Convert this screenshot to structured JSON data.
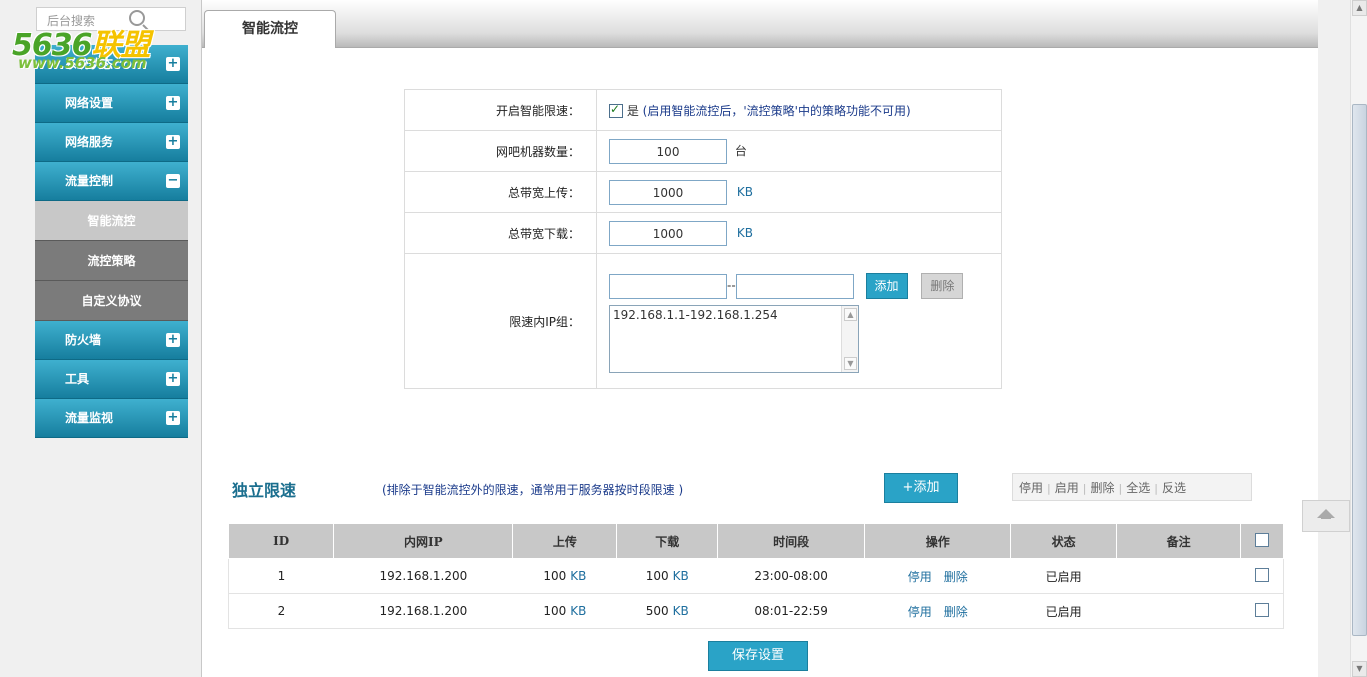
{
  "search": {
    "placeholder": "后台搜索"
  },
  "logo": {
    "main_a": "5636",
    "main_b": "联盟",
    "sub": "www.5636.com"
  },
  "sidebar": {
    "items": [
      {
        "label": "系统状态",
        "expanded": false
      },
      {
        "label": "网络设置",
        "expanded": false
      },
      {
        "label": "网络服务",
        "expanded": false
      },
      {
        "label": "流量控制",
        "expanded": true
      },
      {
        "label": "防火墙",
        "expanded": false
      },
      {
        "label": "工具",
        "expanded": false
      },
      {
        "label": "流量监视",
        "expanded": false
      }
    ],
    "sub_items": [
      {
        "label": "智能流控",
        "active": true
      },
      {
        "label": "流控策略",
        "active": false
      },
      {
        "label": "自定义协议",
        "active": false
      }
    ],
    "plus": "+",
    "minus": "−"
  },
  "tab": {
    "label": "智能流控"
  },
  "form": {
    "enable": {
      "label": "开启智能限速：",
      "checked": true,
      "check_text": "是",
      "hint": "(启用智能流控后，'流控策略'中的策略功能不可用)"
    },
    "machines": {
      "label": "网吧机器数量：",
      "value": "100",
      "unit": "台"
    },
    "upload": {
      "label": "总带宽上传：",
      "value": "1000",
      "unit": "KB"
    },
    "download": {
      "label": "总带宽下载：",
      "value": "1000",
      "unit": "KB"
    },
    "ipgroup": {
      "label": "限速内IP组：",
      "start_value": "",
      "end_value": "",
      "dash": "--",
      "add_label": "添加",
      "delete_label": "删除",
      "list": "192.168.1.1-192.168.1.254"
    }
  },
  "independent": {
    "title": "独立限速",
    "hint": "(排除于智能流控外的限速，通常用于服务器按时段限速 )",
    "add_label": "+添加",
    "actions": [
      "停用",
      "启用",
      "删除",
      "全选",
      "反选"
    ],
    "columns": [
      "ID",
      "内网IP",
      "上传",
      "下载",
      "时间段",
      "操作",
      "状态",
      "备注"
    ],
    "rows": [
      {
        "id": "1",
        "ip": "192.168.1.200",
        "up": "100",
        "up_unit": "KB",
        "down": "100",
        "down_unit": "KB",
        "time": "23:00-08:00",
        "op1": "停用",
        "op2": "删除",
        "status": "已启用",
        "note": ""
      },
      {
        "id": "2",
        "ip": "192.168.1.200",
        "up": "100",
        "up_unit": "KB",
        "down": "500",
        "down_unit": "KB",
        "time": "08:01-22:59",
        "op1": "停用",
        "op2": "删除",
        "status": "已启用",
        "note": ""
      }
    ]
  },
  "save_label": "保存设置",
  "colors": {
    "accent": "#2aa3c7",
    "menu": "#167e9e",
    "status_green": "#1d8a1d",
    "unit_blue": "#1e6e9e"
  }
}
